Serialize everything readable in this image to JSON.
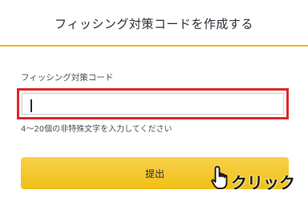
{
  "header": {
    "title": "フィッシング対策コードを作成する"
  },
  "form": {
    "field_label": "フィッシング対策コード",
    "input_value": "",
    "hint": "4〜20個の非特殊文字を入力してください",
    "submit_label": "提出"
  },
  "annotation": {
    "click_text": "クリック",
    "highlight_color": "#e0262b",
    "icon": "hand-pointer-icon"
  },
  "colors": {
    "accent": "#f2b61a",
    "button": "#f3c52a"
  }
}
